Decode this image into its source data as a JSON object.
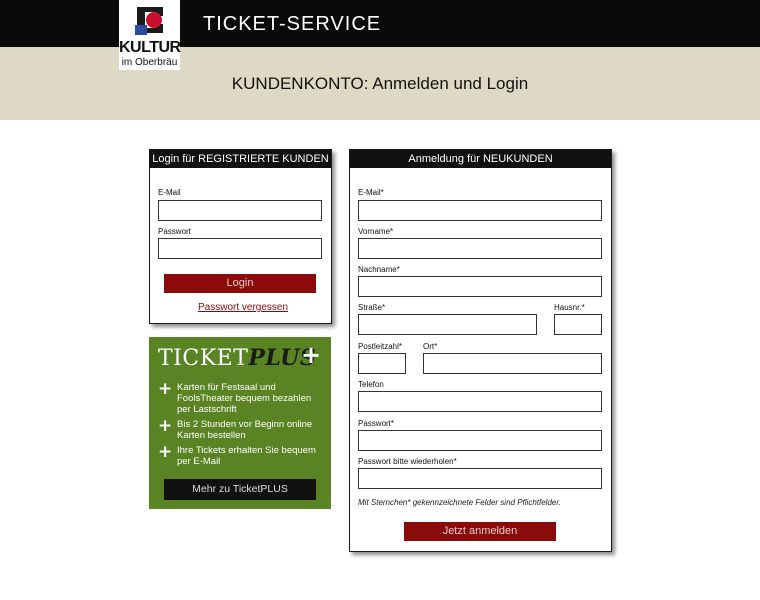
{
  "header": {
    "logo": {
      "line1": "KULTUR",
      "line2": "im Oberbräu"
    },
    "site_title": "TICKET-SERVICE"
  },
  "page": {
    "title": "KUNDENKONTO: Anmelden und Login"
  },
  "login_panel": {
    "title": "Login für REGISTRIERTE KUNDEN",
    "email_label": "E-Mail",
    "email_value": "",
    "password_label": "Passwort",
    "password_value": "",
    "login_button": "Login",
    "forgot_link": "Passwort vergessen"
  },
  "promo": {
    "logo_text": "TICKET",
    "logo_plus": "PLUS",
    "logo_cross": "+",
    "features": [
      "Karten für Festsaal und FoolsTheater bequem bezahlen per Lastschrift",
      "Bis 2 Stunden vor Beginn online Karten bestellen",
      "Ihre Tickets erhalten Sie bequem per E-Mail"
    ],
    "feature_icon": "+",
    "button": "Mehr zu TicketPLUS"
  },
  "register_panel": {
    "title": "Anmeldung für NEUKUNDEN",
    "fields": {
      "email": "E-Mail*",
      "vorname": "Vorname*",
      "nachname": "Nachname*",
      "strasse": "Straße*",
      "hausnr": "Hausnr.*",
      "plz": "Postleitzahl*",
      "ort": "Ort*",
      "telefon": "Telefon",
      "passwort": "Passwort*",
      "passwort2": "Passwort bitte wiederholen*"
    },
    "required_note": "Mit Sternchen* gekennzeichnete Felder sind Pflichtfelder.",
    "submit_button": "Jetzt anmelden"
  },
  "colors": {
    "header_bg": "#0a0a0a",
    "band_bg": "#ddd9c4",
    "accent_red": "#8b0a0a",
    "promo_green": "#5a8423"
  }
}
